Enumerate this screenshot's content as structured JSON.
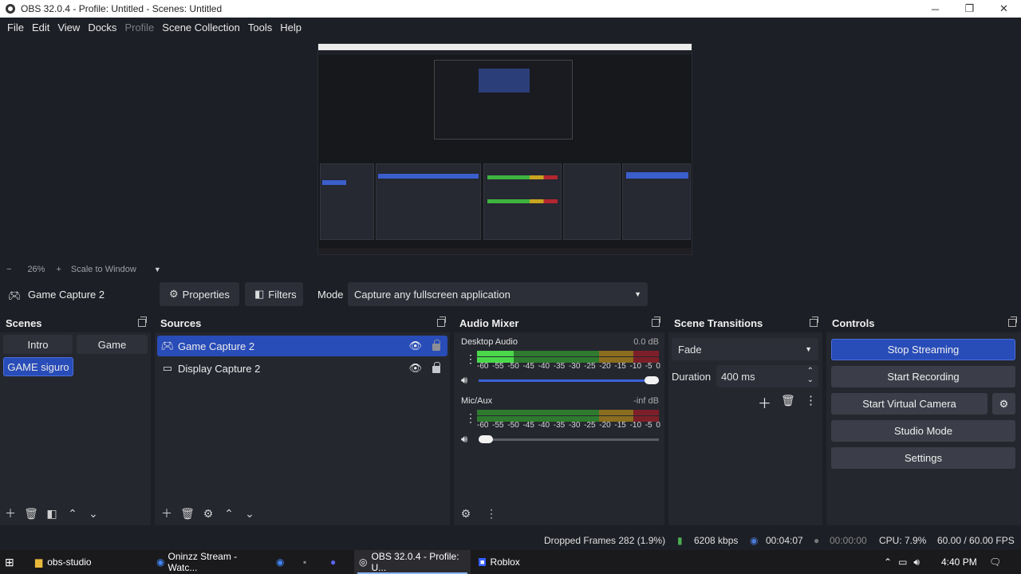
{
  "window": {
    "title": "OBS 32.0.4 - Profile: Untitled - Scenes: Untitled",
    "controls": [
      "minimize-icon",
      "restore-icon",
      "close-icon"
    ]
  },
  "menu": [
    "File",
    "Edit",
    "View",
    "Docks",
    "Profile",
    "Scene Collection",
    "Tools",
    "Help"
  ],
  "zoom": {
    "minus": "−",
    "value": "26%",
    "plus": "+",
    "mode": "Scale to Window"
  },
  "context": {
    "source_name": "Game Capture 2",
    "properties": "Properties",
    "filters": "Filters",
    "mode_label": "Mode",
    "mode_value": "Capture any fullscreen application"
  },
  "scenes": {
    "title": "Scenes",
    "items": [
      "Intro",
      "Game",
      "GAME siguro"
    ],
    "selected": "GAME siguro"
  },
  "sources": {
    "title": "Sources",
    "items": [
      {
        "name": "Game Capture 2",
        "selected": true
      },
      {
        "name": "Display Capture 2",
        "selected": false
      }
    ]
  },
  "mixer": {
    "title": "Audio Mixer",
    "channels": [
      {
        "name": "Desktop Audio",
        "db": "0.0 dB",
        "level": 0.2,
        "volume": 1.0
      },
      {
        "name": "Mic/Aux",
        "db": "-inf dB",
        "level": 0.0,
        "volume": 0.0
      }
    ],
    "scale": [
      "-60",
      "-55",
      "-50",
      "-45",
      "-40",
      "-35",
      "-30",
      "-25",
      "-20",
      "-15",
      "-10",
      "-5",
      "0"
    ]
  },
  "transitions": {
    "title": "Scene Transitions",
    "selected": "Fade",
    "duration_label": "Duration",
    "duration_value": "400 ms"
  },
  "controls": {
    "title": "Controls",
    "stop_streaming": "Stop Streaming",
    "start_recording": "Start Recording",
    "start_virtual_camera": "Start Virtual Camera",
    "studio_mode": "Studio Mode",
    "settings": "Settings"
  },
  "status": {
    "dropped_frames": "Dropped Frames 282 (1.9%)",
    "bitrate": "6208 kbps",
    "stream_time": "00:04:07",
    "record_time": "00:00:00",
    "cpu": "CPU: 7.9%",
    "fps": "60.00 / 60.00 FPS"
  },
  "taskbar": {
    "items": [
      "obs-studio",
      "Oninzz Stream - Watc...",
      "OBS 32.0.4 - Profile: U...",
      "Roblox"
    ],
    "time": "4:40 PM"
  },
  "colors": {
    "accent": "#284cb8",
    "panel": "#25272f",
    "background": "#1d1f26"
  }
}
